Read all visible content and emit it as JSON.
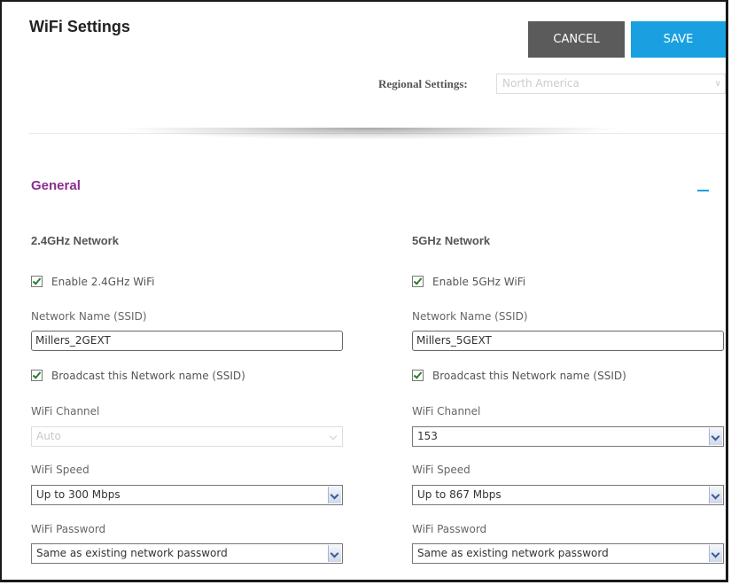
{
  "header": {
    "title": "WiFi Settings",
    "cancel_label": "CANCEL",
    "save_label": "SAVE",
    "regional_label": "Regional Settings:",
    "regional_value": "North America"
  },
  "section": {
    "title": "General",
    "collapse_icon": "minus-icon"
  },
  "networks": [
    {
      "title": "2.4GHz Network",
      "enable_label": "Enable 2.4GHz WiFi",
      "enabled": true,
      "ssid_label": "Network Name (SSID)",
      "ssid_value": "Millers_2GEXT",
      "broadcast_label": "Broadcast this Network name (SSID)",
      "broadcast": true,
      "channel_label": "WiFi Channel",
      "channel_value": "Auto",
      "speed_label": "WiFi Speed",
      "speed_value": "Up to 300 Mbps",
      "password_label": "WiFi Password",
      "password_value": "Same as existing network password"
    },
    {
      "title": "5GHz Network",
      "enable_label": "Enable 5GHz WiFi",
      "enabled": true,
      "ssid_label": "Network Name (SSID)",
      "ssid_value": "Millers_5GEXT",
      "broadcast_label": "Broadcast this Network name (SSID)",
      "broadcast": true,
      "channel_label": "WiFi Channel",
      "channel_value": "153",
      "speed_label": "WiFi Speed",
      "speed_value": "Up to 867 Mbps",
      "password_label": "WiFi Password",
      "password_value": "Same as existing network password"
    }
  ],
  "colors": {
    "accent_blue": "#1aa0e0",
    "cancel_gray": "#5b5b5b",
    "section_purple": "#8b2d8f"
  }
}
